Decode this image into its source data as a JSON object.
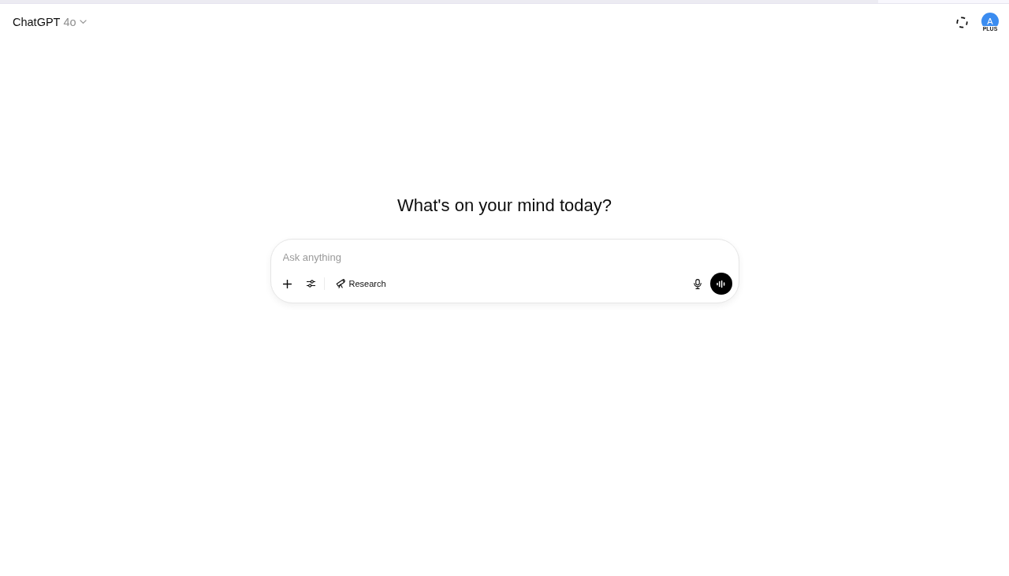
{
  "loading_bar": {
    "level": 0.87
  },
  "header": {
    "model_name": "ChatGPT",
    "model_version": "4o",
    "avatar": {
      "initial": "A",
      "badge": "PLUS"
    }
  },
  "heading": "What's on your mind today?",
  "composer": {
    "placeholder": "Ask anything",
    "tools": [
      {
        "kind": "add"
      },
      {
        "kind": "tools"
      },
      {
        "kind": "divider"
      },
      {
        "kind": "research",
        "label": "Research"
      }
    ]
  }
}
